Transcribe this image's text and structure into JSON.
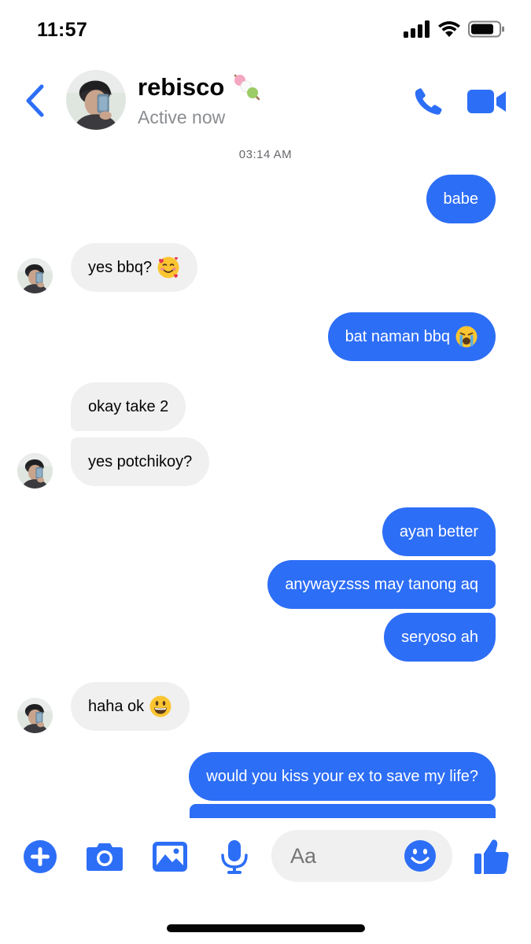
{
  "status_bar": {
    "time": "11:57"
  },
  "header": {
    "contact_name": "rebisco",
    "contact_status": "Active now",
    "name_emoji": "dango-icon"
  },
  "conversation": {
    "timestamp": "03:14 AM",
    "messages": [
      {
        "from": "me",
        "text": "babe"
      },
      {
        "from": "them",
        "text": "yes bbq?",
        "emoji": "smiling-face-with-hearts"
      },
      {
        "from": "me",
        "text": "bat naman bbq",
        "emoji": "loudly-crying-face"
      },
      {
        "from": "them",
        "text": "okay take 2"
      },
      {
        "from": "them",
        "text": "yes potchikoy?"
      },
      {
        "from": "me",
        "text": "ayan better"
      },
      {
        "from": "me",
        "text": "anywayzsss may tanong aq"
      },
      {
        "from": "me",
        "text": "seryoso ah"
      },
      {
        "from": "them",
        "text": "haha ok",
        "emoji": "grinning-face"
      },
      {
        "from": "me",
        "text": "would you kiss your ex to save my life?"
      }
    ]
  },
  "composer": {
    "placeholder": "Aa"
  },
  "colors": {
    "accent": "#2d6ef6",
    "incoming_bubble": "#f0f0f0",
    "muted_text": "#8a8d91"
  }
}
